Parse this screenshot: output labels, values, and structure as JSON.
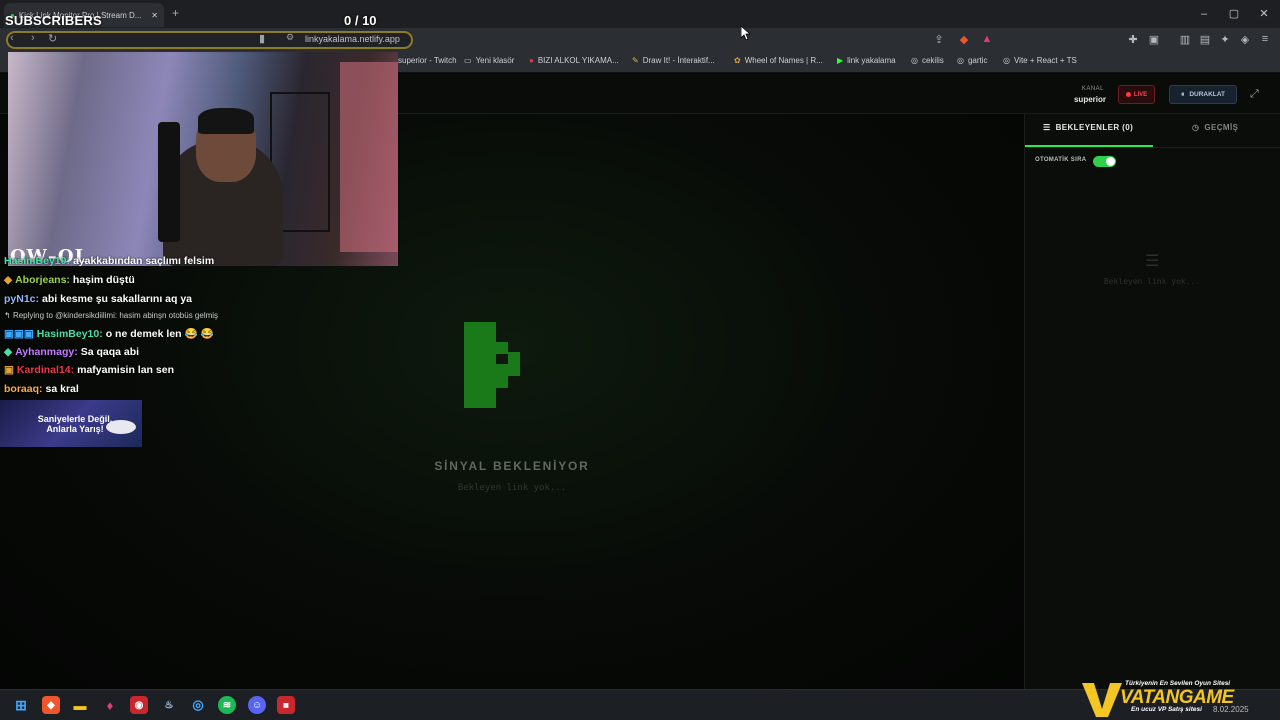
{
  "browser": {
    "tab_title": "Kick Link Monitor Pro | Stream D...",
    "url": "linkyakalama.netlify.app",
    "bookmarks": [
      "superior - Twitch",
      "Yeni klasör",
      "BIZI ALKOL YIKAMA...",
      "Draw It! - İnteraktif...",
      "Wheel of Names | R...",
      "link yakalama",
      "cekilis",
      "gartic",
      "Vite + React + TS"
    ]
  },
  "overlay": {
    "subs_label": "SUBSCRIBERS",
    "counter": "0  / 10",
    "watermark": "OW–OL"
  },
  "header": {
    "channel_label": "KANAL",
    "channel_name": "superior",
    "live_label": "LIVE",
    "pause_label": "DURAKLAT"
  },
  "main": {
    "status": "SİNYAL BEKLENİYOR",
    "sub": "Bekleyen link yok..."
  },
  "sidebar": {
    "tab_waiting": "BEKLEYENLER (0)",
    "tab_history": "GEÇMİŞ",
    "auto_queue": "OTOMATİK SIRA",
    "auto_queue_on": true,
    "empty": "Bekleyen link yok..."
  },
  "chat": {
    "messages": [
      {
        "user": "HasimBey10:",
        "text": "ayakkabından saçlımı felsim",
        "color": "#48e0a6"
      },
      {
        "user": "Aborjeans:",
        "text": "haşim düştü",
        "color": "#9ad34b"
      },
      {
        "user": "pyN1c:",
        "text": "abi kesme şu sakallarını aq ya",
        "color": "#8fb7ff"
      },
      {
        "reply": "Replying to @kindersikdiilimi: hasim abinşn otobüs gelmiş"
      },
      {
        "user": "HasimBey10:",
        "text": "o ne demek len 😂 😂",
        "color": "#48e0a6"
      },
      {
        "user": "Ayhanmagy:",
        "text": "Sa qaqa abi",
        "color": "#c27cff"
      },
      {
        "user": "Kardinal14:",
        "text": "mafyamisin lan sen",
        "color": "#e8394a"
      },
      {
        "user": "boraaq:",
        "text": "sa kral",
        "color": "#ffa94d"
      }
    ]
  },
  "ad": {
    "text": "Saniyelerle Değil, Anlarla Yarış!"
  },
  "vatangame": {
    "tagline": "Türkiyenin En Sevilen Oyun Sitesi",
    "name": "VATANGAME",
    "sub": "En ucuz VP Satış sitesi",
    "date": "8.02.2025"
  },
  "colors": {
    "accent_green": "#2ee84f",
    "live_red": "#ff3b3b",
    "brand_yellow": "#f3c623"
  }
}
